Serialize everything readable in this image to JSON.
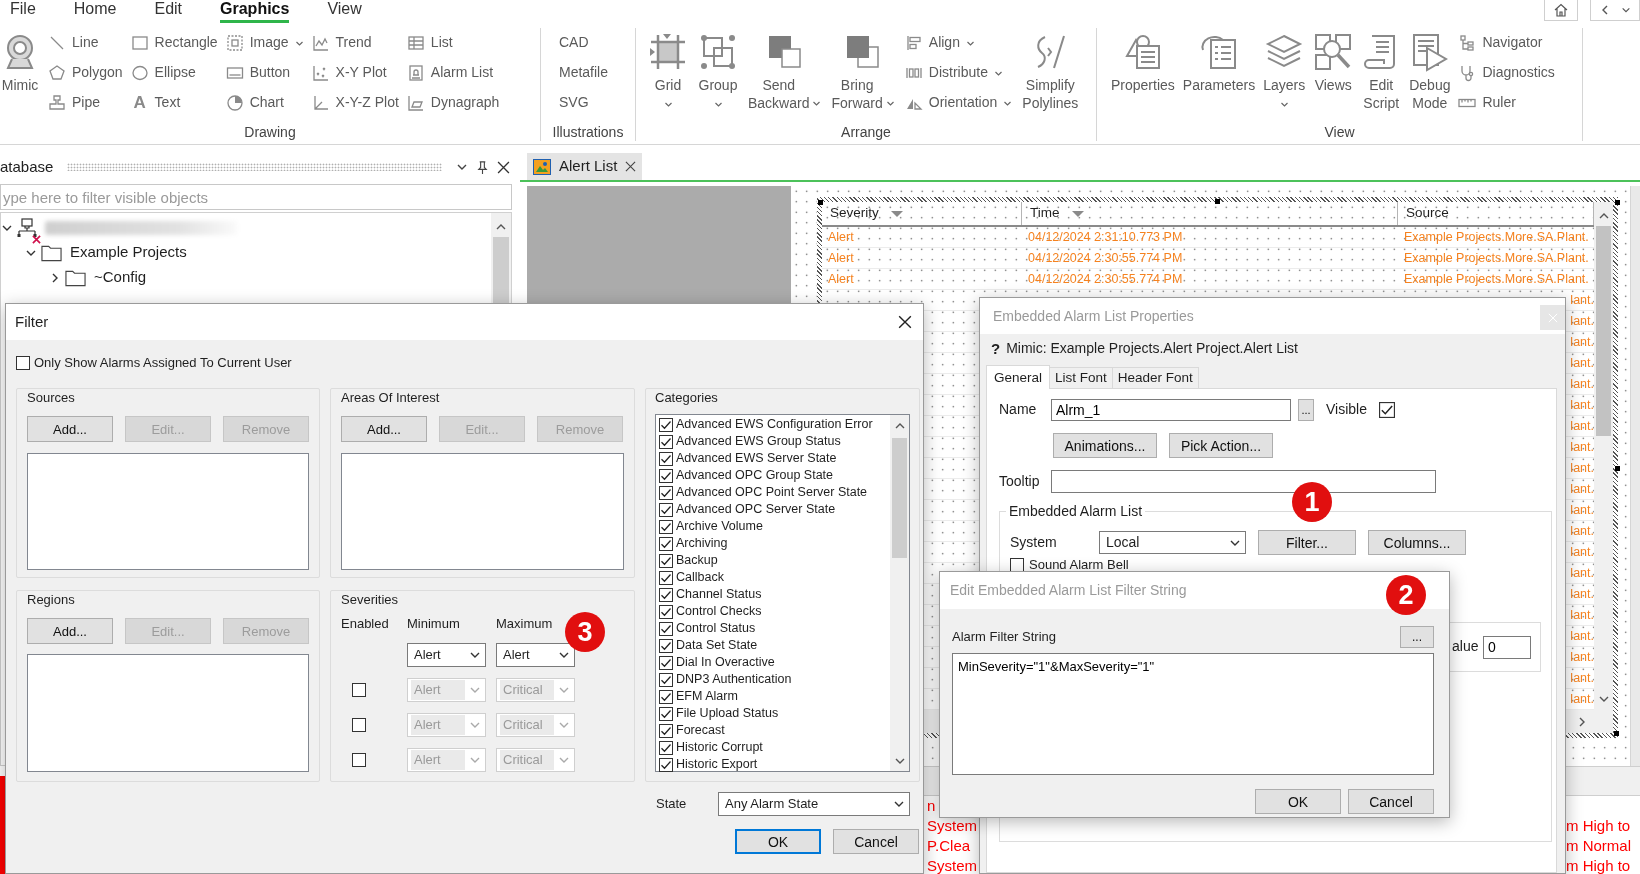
{
  "menu": {
    "tabs": [
      {
        "label": "File",
        "selected": false
      },
      {
        "label": "Home",
        "selected": false
      },
      {
        "label": "Edit",
        "selected": false
      },
      {
        "label": "Graphics",
        "selected": true
      },
      {
        "label": "View",
        "selected": false
      }
    ]
  },
  "ribbon": {
    "groups": [
      {
        "label": "Drawing",
        "items": [
          {
            "kind": "large",
            "label": "Mimic",
            "dropdown": false
          },
          {
            "kind": "small",
            "label": "Line",
            "dropdown": false
          },
          {
            "kind": "small",
            "label": "Polygon",
            "dropdown": false
          },
          {
            "kind": "small",
            "label": "Pipe",
            "dropdown": false
          },
          {
            "kind": "small",
            "label": "Rectangle",
            "dropdown": false
          },
          {
            "kind": "small",
            "label": "Ellipse",
            "dropdown": false
          },
          {
            "kind": "small",
            "label": "Text",
            "glyph": "A",
            "dropdown": false
          },
          {
            "kind": "small",
            "label": "Image",
            "dropdown": true
          },
          {
            "kind": "small",
            "label": "Button",
            "dropdown": false
          },
          {
            "kind": "small",
            "label": "Chart",
            "dropdown": false
          },
          {
            "kind": "small",
            "label": "Trend",
            "dropdown": false
          },
          {
            "kind": "small",
            "label": "X-Y Plot",
            "dropdown": false
          },
          {
            "kind": "small",
            "label": "X-Y-Z Plot",
            "dropdown": false
          },
          {
            "kind": "small",
            "label": "List",
            "dropdown": false
          },
          {
            "kind": "small",
            "label": "Alarm List",
            "dropdown": false
          },
          {
            "kind": "small",
            "label": "Dynagraph",
            "dropdown": false
          }
        ]
      },
      {
        "label": "Illustrations",
        "items": [
          {
            "kind": "text",
            "label": "CAD",
            "dropdown": false
          },
          {
            "kind": "text",
            "label": "Metafile",
            "dropdown": false
          },
          {
            "kind": "text",
            "label": "SVG",
            "dropdown": false
          }
        ]
      },
      {
        "label": "Arrange",
        "items": [
          {
            "kind": "large",
            "label": "Grid",
            "dropdown": true
          },
          {
            "kind": "large",
            "label": "Group",
            "dropdown": true
          },
          {
            "kind": "large",
            "label": "Send Backward",
            "dropdown": true
          },
          {
            "kind": "large",
            "label": "Bring Forward",
            "dropdown": true
          },
          {
            "kind": "small",
            "label": "Align",
            "dropdown": true
          },
          {
            "kind": "small",
            "label": "Distribute",
            "dropdown": true
          },
          {
            "kind": "small",
            "label": "Orientation",
            "dropdown": true
          },
          {
            "kind": "large",
            "label": "Simplify Polylines",
            "dropdown": false
          }
        ]
      },
      {
        "label": "View",
        "items": [
          {
            "kind": "large",
            "label": "Properties",
            "dropdown": false
          },
          {
            "kind": "large",
            "label": "Parameters",
            "dropdown": false
          },
          {
            "kind": "large",
            "label": "Layers",
            "dropdown": true
          },
          {
            "kind": "large",
            "label": "Views",
            "dropdown": false
          },
          {
            "kind": "large",
            "label": "Edit Script",
            "dropdown": false
          },
          {
            "kind": "large",
            "label": "Debug Mode",
            "dropdown": false
          },
          {
            "kind": "small",
            "label": "Navigator",
            "dropdown": false
          },
          {
            "kind": "small",
            "label": "Diagnostics",
            "dropdown": false
          },
          {
            "kind": "small",
            "label": "Ruler",
            "dropdown": false
          }
        ]
      }
    ]
  },
  "database_panel": {
    "title": "atabase",
    "filter": {
      "placeholder": "ype here to filter visible objects"
    },
    "tree": [
      {
        "kind": "server",
        "redacted": true,
        "error": true,
        "expanded": true,
        "children": [
          {
            "kind": "folder",
            "label": "Example Projects",
            "error": false,
            "expanded": true,
            "children": [
              {
                "kind": "folder",
                "label": "~Config",
                "error": false,
                "expanded": false
              }
            ]
          }
        ]
      }
    ]
  },
  "document_tabs": [
    {
      "label": "Alert List",
      "selected": true
    }
  ],
  "alarm_list": {
    "columns": [
      {
        "label": "Severity",
        "sorted": true
      },
      {
        "label": "Time",
        "sorted": true
      },
      {
        "label": "Source",
        "sorted": false
      }
    ],
    "rows": [
      {
        "severity": "Alert",
        "time": "04/12/2024 2:31:10.773 PM",
        "source": "Example Projects.More.SA.Plant."
      },
      {
        "severity": "Alert",
        "time": "04/12/2024 2:30:55.774 PM",
        "source": "Example Projects.More.SA.Plant."
      },
      {
        "severity": "Alert",
        "time": "04/12/2024 2:30:55.774 PM",
        "source": "Example Projects.More.SA.Plant."
      },
      {
        "source": "lant."
      },
      {
        "source": "lant."
      },
      {
        "source": "lant."
      },
      {
        "source": "lant."
      },
      {
        "source": "lant."
      },
      {
        "source": "lant."
      },
      {
        "source": "lant."
      },
      {
        "source": "lant."
      },
      {
        "source": "lant."
      },
      {
        "source": "lant."
      },
      {
        "source": "lant."
      },
      {
        "source": "lant."
      },
      {
        "source": "lant."
      },
      {
        "source": "lant."
      },
      {
        "source": "lant."
      },
      {
        "source": "lant."
      },
      {
        "source": "lant."
      },
      {
        "source": "lant."
      },
      {
        "source": "lant."
      },
      {
        "source": "lant."
      }
    ]
  },
  "alarm_banner": {
    "rows": [
      {
        "left_part": "n"
      },
      {
        "left_part": "System",
        "right_part": "m High to"
      },
      {
        "left_part": "P.Clea",
        "right_part": "m Normal"
      },
      {
        "left_part": "System",
        "right_part": "m High to"
      }
    ]
  },
  "filter_dialog": {
    "title": "Filter",
    "only_assigned": {
      "label": "Only Show Alarms Assigned To Current User",
      "checked": false
    },
    "sources": {
      "title": "Sources",
      "buttons": [
        {
          "label": "Add...",
          "disabled": false
        },
        {
          "label": "Edit...",
          "disabled": true
        },
        {
          "label": "Remove",
          "disabled": true
        }
      ]
    },
    "areas_of_interest": {
      "title": "Areas Of Interest",
      "buttons": [
        {
          "label": "Add...",
          "disabled": false
        },
        {
          "label": "Edit...",
          "disabled": true
        },
        {
          "label": "Remove",
          "disabled": true
        }
      ]
    },
    "regions": {
      "title": "Regions",
      "buttons": [
        {
          "label": "Add...",
          "disabled": false
        },
        {
          "label": "Edit...",
          "disabled": true
        },
        {
          "label": "Remove",
          "disabled": true
        }
      ]
    },
    "severities": {
      "title": "Severities",
      "headers": [
        "Enabled",
        "Minimum",
        "Maximum"
      ],
      "rows": [
        {
          "kind": "fixed",
          "enabled": true,
          "minimum": "Alert",
          "maximum": "Alert"
        },
        {
          "kind": "optional",
          "enabled": false,
          "minimum": "Alert",
          "maximum": "Critical"
        },
        {
          "kind": "optional",
          "enabled": false,
          "minimum": "Alert",
          "maximum": "Critical"
        },
        {
          "kind": "optional",
          "enabled": false,
          "minimum": "Alert",
          "maximum": "Critical"
        }
      ]
    },
    "categories": {
      "title": "Categories",
      "items": [
        {
          "label": "Advanced EWS Configuration Error",
          "checked": true
        },
        {
          "label": "Advanced EWS Group Status",
          "checked": true
        },
        {
          "label": "Advanced EWS Server State",
          "checked": true
        },
        {
          "label": "Advanced OPC Group State",
          "checked": true
        },
        {
          "label": "Advanced OPC Point Server State",
          "checked": true
        },
        {
          "label": "Advanced OPC Server State",
          "checked": true
        },
        {
          "label": "Archive Volume",
          "checked": true
        },
        {
          "label": "Archiving",
          "checked": true
        },
        {
          "label": "Backup",
          "checked": true
        },
        {
          "label": "Callback",
          "checked": true
        },
        {
          "label": "Channel Status",
          "checked": true
        },
        {
          "label": "Control Checks",
          "checked": true
        },
        {
          "label": "Control Status",
          "checked": true
        },
        {
          "label": "Data Set State",
          "checked": true
        },
        {
          "label": "Dial In Overactive",
          "checked": true
        },
        {
          "label": "DNP3 Authentication",
          "checked": true
        },
        {
          "label": "EFM Alarm",
          "checked": true
        },
        {
          "label": "File Upload Status",
          "checked": true
        },
        {
          "label": "Forecast",
          "checked": true
        },
        {
          "label": "Historic Corrupt",
          "checked": true
        },
        {
          "label": "Historic Export",
          "checked": true
        }
      ]
    },
    "state": {
      "label": "State",
      "value": "Any Alarm State"
    },
    "buttons": [
      {
        "label": "OK",
        "default": true
      },
      {
        "label": "Cancel",
        "default": false
      }
    ]
  },
  "properties_dialog": {
    "title": "Embedded Alarm List Properties",
    "help_mark": "?",
    "mimic_path": "Mimic: Example Projects.Alert Project.Alert List",
    "tabs": [
      {
        "label": "General",
        "selected": true
      },
      {
        "label": "List Font",
        "selected": false
      },
      {
        "label": "Header Font",
        "selected": false
      }
    ],
    "name": {
      "label": "Name",
      "value": "Alrm_1",
      "browse": "..."
    },
    "visible": {
      "label": "Visible",
      "checked": true
    },
    "buttons": [
      "Animations...",
      "Pick Action..."
    ],
    "tooltip": {
      "label": "Tooltip"
    },
    "embedded_alarm_list": {
      "title": "Embedded Alarm List",
      "system": {
        "label": "System",
        "value": "Local"
      },
      "buttons": [
        "Filter...",
        "Columns..."
      ],
      "sound_alarm_bell": {
        "label": "Sound Alarm Bell",
        "checked": false
      },
      "value": {
        "label": "alue",
        "value": "0"
      }
    }
  },
  "filter_string_dialog": {
    "title": "Edit Embedded Alarm List Filter String",
    "field_label": "Alarm Filter String",
    "browse": "...",
    "value": "MinSeverity=\"1\"&MaxSeverity=\"1\"",
    "buttons": [
      "OK",
      "Cancel"
    ]
  },
  "callouts": [
    {
      "label": "1"
    },
    {
      "label": "2"
    },
    {
      "label": "3"
    }
  ]
}
